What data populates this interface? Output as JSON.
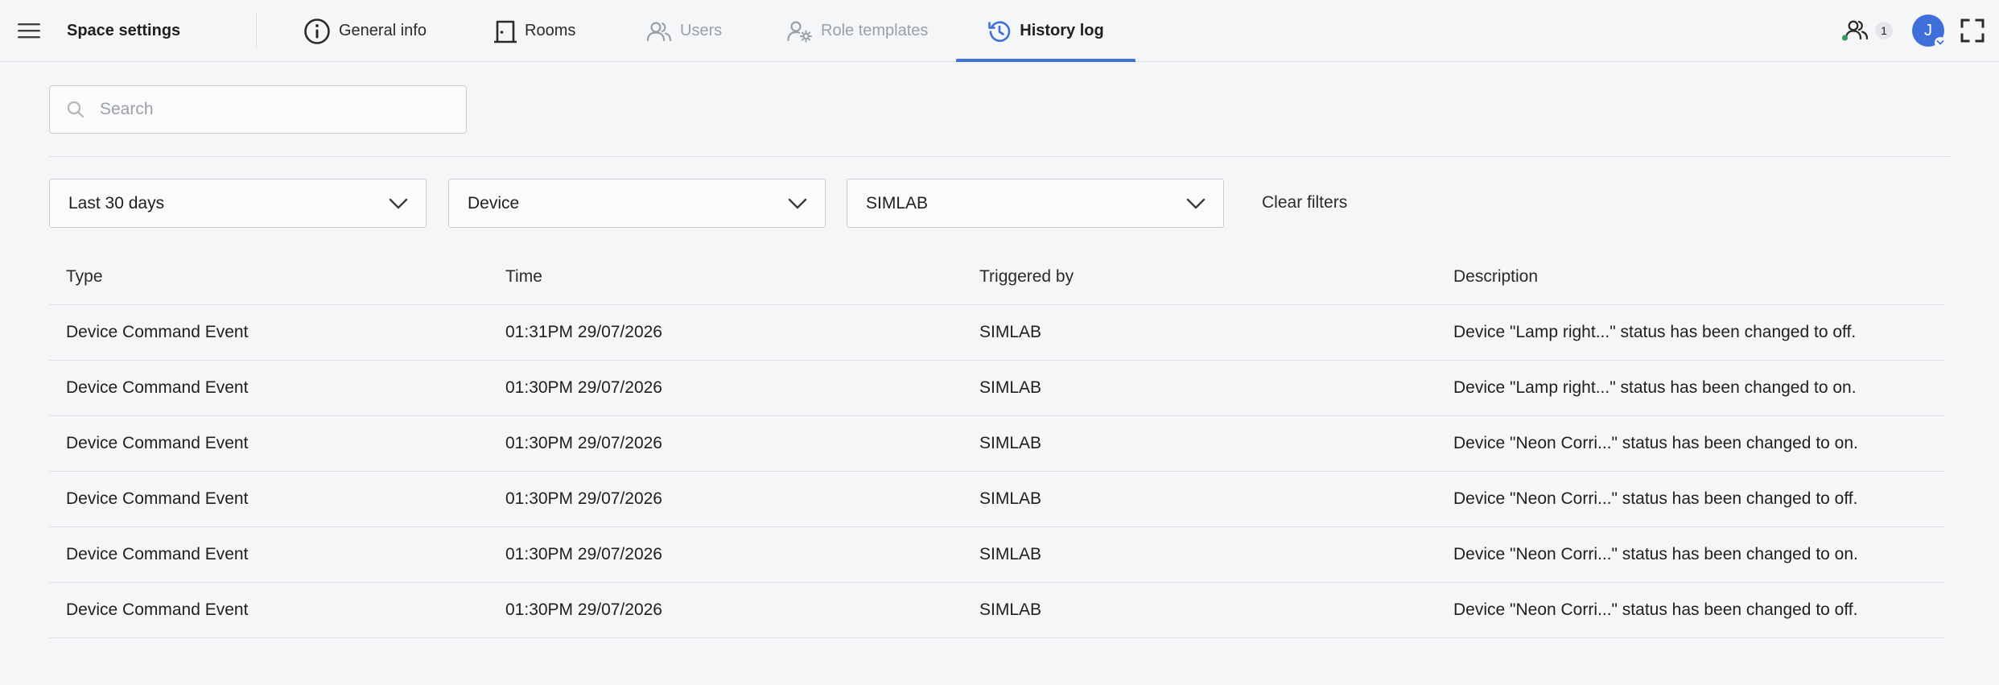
{
  "header": {
    "title": "Space settings",
    "tabs": [
      {
        "label": "General info",
        "icon": "info-icon",
        "state": "normal"
      },
      {
        "label": "Rooms",
        "icon": "door-icon",
        "state": "normal"
      },
      {
        "label": "Users",
        "icon": "users-icon",
        "state": "disabled"
      },
      {
        "label": "Role templates",
        "icon": "user-gear-icon",
        "state": "disabled"
      },
      {
        "label": "History log",
        "icon": "history-icon",
        "state": "active"
      }
    ],
    "online_count": "1",
    "avatar_initial": "J"
  },
  "search": {
    "placeholder": "Search",
    "value": ""
  },
  "filters": {
    "period": "Last 30 days",
    "type": "Device",
    "trigger": "SIMLAB",
    "clear_label": "Clear filters"
  },
  "table": {
    "columns": [
      "Type",
      "Time",
      "Triggered by",
      "Description"
    ],
    "rows": [
      [
        "Device Command Event",
        "01:31PM 29/07/2026",
        "SIMLAB",
        "Device \"Lamp right...\" status has been changed to off."
      ],
      [
        "Device Command Event",
        "01:30PM 29/07/2026",
        "SIMLAB",
        "Device \"Lamp right...\" status has been changed to on."
      ],
      [
        "Device Command Event",
        "01:30PM 29/07/2026",
        "SIMLAB",
        "Device \"Neon Corri...\" status has been changed to on."
      ],
      [
        "Device Command Event",
        "01:30PM 29/07/2026",
        "SIMLAB",
        "Device \"Neon Corri...\" status has been changed to off."
      ],
      [
        "Device Command Event",
        "01:30PM 29/07/2026",
        "SIMLAB",
        "Device \"Neon Corri...\" status has been changed to on."
      ],
      [
        "Device Command Event",
        "01:30PM 29/07/2026",
        "SIMLAB",
        "Device \"Neon Corri...\" status has been changed to off."
      ]
    ]
  },
  "colors": {
    "accent": "#3f6fd8",
    "online_dot": "#2e9d4f",
    "disabled_text": "#9aa0a8"
  }
}
